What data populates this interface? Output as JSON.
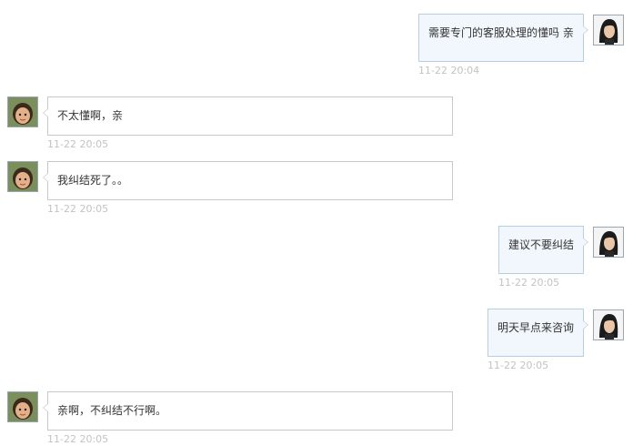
{
  "messages": [
    {
      "side": "right",
      "avatar": "agent-avatar",
      "text": "需要专门的客服处理的懂吗 亲",
      "time": "11-22 20:04"
    },
    {
      "side": "left",
      "avatar": "user-avatar",
      "text": "不太懂啊，亲",
      "time": "11-22 20:05"
    },
    {
      "side": "left",
      "avatar": "user-avatar",
      "text": "我纠结死了。。",
      "time": "11-22 20:05"
    },
    {
      "side": "right",
      "avatar": "agent-avatar",
      "text": "建议不要纠结",
      "time": "11-22 20:05"
    },
    {
      "side": "right",
      "avatar": "agent-avatar",
      "text": "明天早点来咨询",
      "time": "11-22 20:05"
    },
    {
      "side": "left",
      "avatar": "user-avatar",
      "text": "亲啊，不纠结不行啊。",
      "time": "11-22 20:05"
    }
  ],
  "colors": {
    "user_bubble_bg": "#f1f7fc",
    "user_bubble_border": "#b7cfe1",
    "agent_bubble_border": "#c8c8c8",
    "timestamp": "#c3c3c3"
  }
}
